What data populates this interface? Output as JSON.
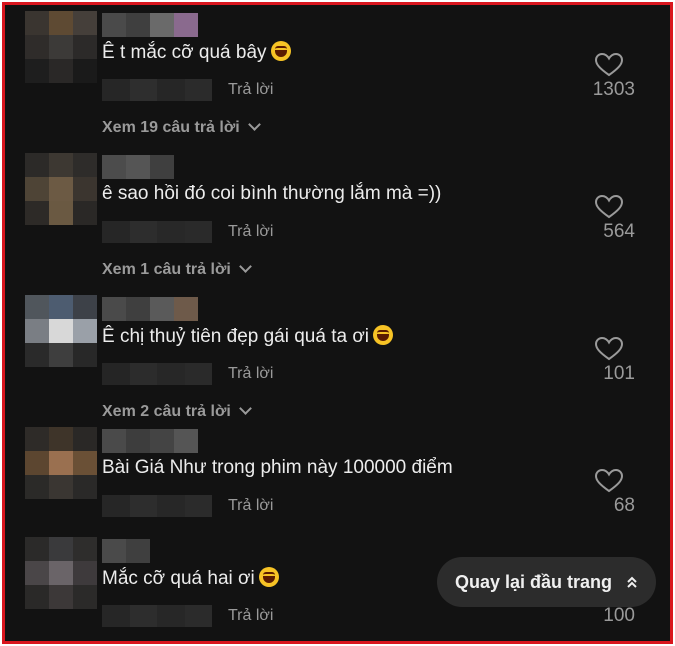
{
  "comments": [
    {
      "text": "Ê t mắc cỡ quá bây",
      "emoji": true,
      "reply_label": "Trả lời",
      "likes": "1303",
      "view_replies": "Xem 19 câu trả lời",
      "avatar_colors": [
        "#3a3530",
        "#5e4a33",
        "#453f3a",
        "#2f2c2a",
        "#3c3a38",
        "#2c2a29",
        "#1e1e1e",
        "#2a2827",
        "#1a1a1a"
      ],
      "name_colors": [
        "#4a4a4a",
        "#3f3f3f",
        "#6a6a6a",
        "#8a6a8e"
      ]
    },
    {
      "text": "ê sao hồi đó coi bình thường lắm mà =))",
      "emoji": false,
      "reply_label": "Trả lời",
      "likes": "564",
      "view_replies": "Xem 1 câu trả lời",
      "avatar_colors": [
        "#2c2a28",
        "#3d3832",
        "#2e2c2a",
        "#4e4436",
        "#6c5a44",
        "#3b352f",
        "#2d2a27",
        "#6a5942",
        "#2a2826"
      ],
      "name_colors": [
        "#4c4c4c",
        "#555555",
        "#3f3f3f"
      ]
    },
    {
      "text": "Ê chị thuỷ tiên đẹp gái quá ta ơi",
      "emoji": true,
      "reply_label": "Trả lời",
      "likes": "101",
      "view_replies": "Xem 2 câu trả lời",
      "avatar_colors": [
        "#50565c",
        "#4d5c70",
        "#3d4148",
        "#7a7e84",
        "#d8d8d8",
        "#9aa0a8",
        "#2a2a2a",
        "#3e3e3e",
        "#282828"
      ],
      "name_colors": [
        "#4a4a4a",
        "#3f3f3f",
        "#5a5a5a",
        "#6e5a4a"
      ]
    },
    {
      "text": "Bài Giá Như trong phim này 100000 điểm",
      "emoji": false,
      "reply_label": "Trả lời",
      "likes": "68",
      "view_replies": "",
      "avatar_colors": [
        "#2e2b28",
        "#3e3429",
        "#2a2826",
        "#5c4630",
        "#9a7050",
        "#6a5036",
        "#2b2a28",
        "#3a3632",
        "#2a2928"
      ],
      "name_colors": [
        "#4a4a4a",
        "#3d3d3d",
        "#444444",
        "#555555"
      ]
    },
    {
      "text": "Mắc cỡ quá hai ơi",
      "emoji": true,
      "reply_label": "Trả lời",
      "likes": "100",
      "view_replies": "",
      "avatar_colors": [
        "#2b2a29",
        "#3a3a3c",
        "#2e2d2c",
        "#4a4648",
        "#6a6468",
        "#3e3a3c",
        "#2a2928",
        "#3c3838",
        "#2b2a29"
      ],
      "name_colors": [
        "#4a4a4a",
        "#3f3f3f"
      ]
    }
  ],
  "back_to_top": {
    "label": "Quay lại đầu trang",
    "icon": "double-chevron-up-icon"
  },
  "colors": {
    "background": "#121212",
    "border": "#d9161e",
    "text": "#ececec",
    "muted": "#9a9a9a"
  }
}
